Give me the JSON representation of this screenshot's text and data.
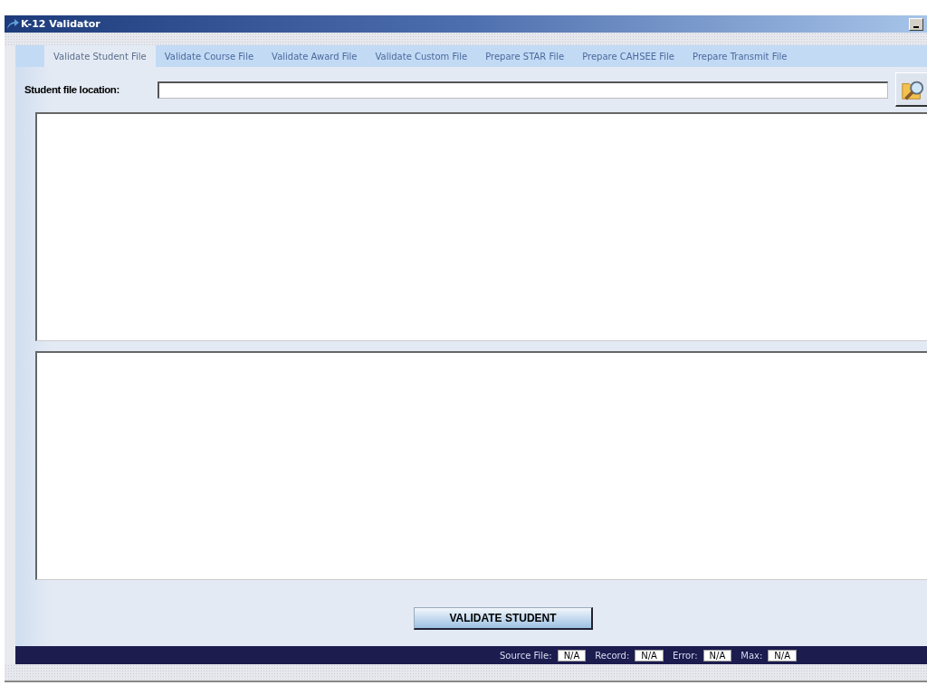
{
  "window": {
    "title": "K-12 Validator"
  },
  "tabs": [
    {
      "label": "Validate Student File",
      "selected": true
    },
    {
      "label": "Validate Course File",
      "selected": false
    },
    {
      "label": "Validate Award File",
      "selected": false
    },
    {
      "label": "Validate Custom File",
      "selected": false
    },
    {
      "label": "Prepare STAR File",
      "selected": false
    },
    {
      "label": "Prepare CAHSEE File",
      "selected": false
    },
    {
      "label": "Prepare Transmit File",
      "selected": false
    }
  ],
  "file_location": {
    "label": "Student file location:"
  },
  "action_button": "VALIDATE STUDENT",
  "status_bar": [
    {
      "label": "Source File:",
      "value": "N/A"
    },
    {
      "label": "Record:",
      "value": "N/A"
    },
    {
      "label": "Error:",
      "value": "N/A"
    },
    {
      "label": "Max:",
      "value": "N/A"
    }
  ]
}
